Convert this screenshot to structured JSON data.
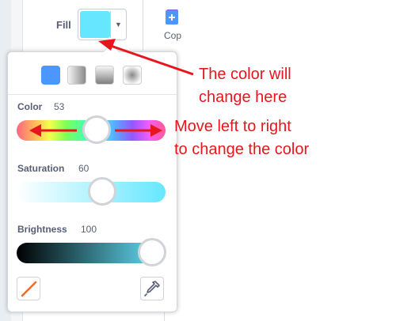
{
  "toolbar": {
    "fill_label": "Fill",
    "fill_color": "#66e7ff",
    "copy_label": "Cop"
  },
  "color_picker": {
    "modes": [
      "solid-fill",
      "horizontal-gradient",
      "vertical-gradient",
      "radial-gradient"
    ],
    "selected_mode": "solid-fill",
    "color": {
      "label": "Color",
      "value": "53"
    },
    "saturation": {
      "label": "Saturation",
      "value": "60"
    },
    "brightness": {
      "label": "Brightness",
      "value": "100"
    }
  },
  "annotations": {
    "top_line1": "The color will",
    "top_line2": "change here",
    "mid_line1": "Move left to right",
    "mid_line2": "to change the color"
  },
  "colors": {
    "accent": "#4c97ff",
    "annotation": "#e8161c",
    "fill_swatch": "#66e7ff"
  }
}
